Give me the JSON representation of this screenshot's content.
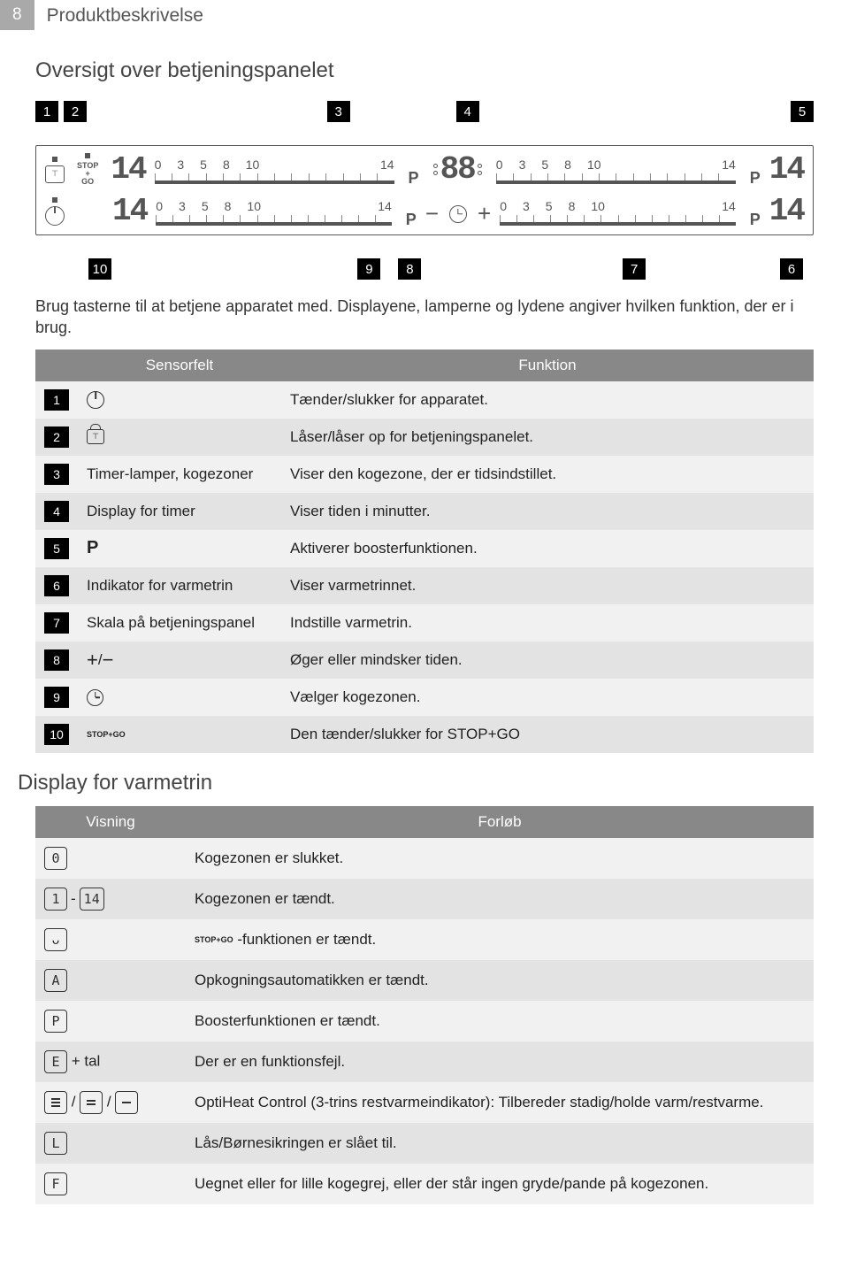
{
  "page_number": "8",
  "chapter": "Produktbeskrivelse",
  "section_title": "Oversigt over betjeningspanelet",
  "diagram": {
    "top_callouts": [
      "1",
      "2",
      "3",
      "4",
      "5"
    ],
    "bottom_callouts": [
      "10",
      "9",
      "8",
      "7",
      "6"
    ],
    "scale_nums": [
      "0",
      "3",
      "5",
      "8",
      "10",
      "14"
    ],
    "scale_p": "P",
    "seg_14": "14",
    "seg_88": "88",
    "stopgo_top": "STOP",
    "stopgo_mid": "+",
    "stopgo_bot": "GO"
  },
  "intro_text": "Brug tasterne til at betjene apparatet med. Displayene, lamperne og lydene angiver hvilken funktion, der er i brug.",
  "table1": {
    "headers": {
      "col2": "Sensorfelt",
      "col3": "Funktion"
    },
    "rows": [
      {
        "n": "1",
        "icon": "power",
        "label": "",
        "func": "Tænder/slukker for apparatet."
      },
      {
        "n": "2",
        "icon": "lock",
        "label": "",
        "func": "Låser/låser op for betjeningspanelet."
      },
      {
        "n": "3",
        "icon": "",
        "label": "Timer-lamper, kogezoner",
        "func": "Viser den kogezone, der er tidsindstillet."
      },
      {
        "n": "4",
        "icon": "",
        "label": "Display for timer",
        "func": "Viser tiden i minutter."
      },
      {
        "n": "5",
        "icon": "p",
        "label": "",
        "func": "Aktiverer boosterfunktionen."
      },
      {
        "n": "6",
        "icon": "",
        "label": "Indikator for varmetrin",
        "func": "Viser varmetrinnet."
      },
      {
        "n": "7",
        "icon": "",
        "label": "Skala på betjeningspanel",
        "func": "Indstille varmetrin."
      },
      {
        "n": "8",
        "icon": "plusminus",
        "label": "",
        "func": "Øger eller mindsker tiden."
      },
      {
        "n": "9",
        "icon": "clock",
        "label": "",
        "func": "Vælger kogezonen."
      },
      {
        "n": "10",
        "icon": "stopgo",
        "label": "",
        "func": "Den tænder/slukker for STOP+GO"
      }
    ]
  },
  "section2_title": "Display for varmetrin",
  "table2": {
    "headers": {
      "col1": "Visning",
      "col2": "Forløb"
    },
    "rows": [
      {
        "disp": "d0",
        "text": "Kogezonen er slukket."
      },
      {
        "disp": "d1_14",
        "text": "Kogezonen er tændt."
      },
      {
        "disp": "du",
        "text_prefix_icon": "stopgo",
        "text": " -funktionen er tændt."
      },
      {
        "disp": "dA",
        "text": "Opkogningsautomatikken er tændt."
      },
      {
        "disp": "dP",
        "text": "Boosterfunktionen er tændt."
      },
      {
        "disp": "dE_tal",
        "tal": " + tal",
        "text": "Der er en funktionsfejl."
      },
      {
        "disp": "dbars",
        "text": "OptiHeat Control (3-trins restvarmeindikator): Tilbereder stadig/holde varm/restvarme."
      },
      {
        "disp": "dL",
        "text": "Lås/Børnesikringen er slået til."
      },
      {
        "disp": "dF",
        "text": "Uegnet eller for lille kogegrej, eller der står ingen gryde/pande på kogezonen."
      }
    ],
    "glyphs": {
      "d0": "0",
      "d1": "1",
      "d14": "14",
      "du": "ᴗ",
      "dA": "A",
      "dP": "P",
      "dE": "E",
      "dL": "L",
      "dF": "F"
    }
  }
}
